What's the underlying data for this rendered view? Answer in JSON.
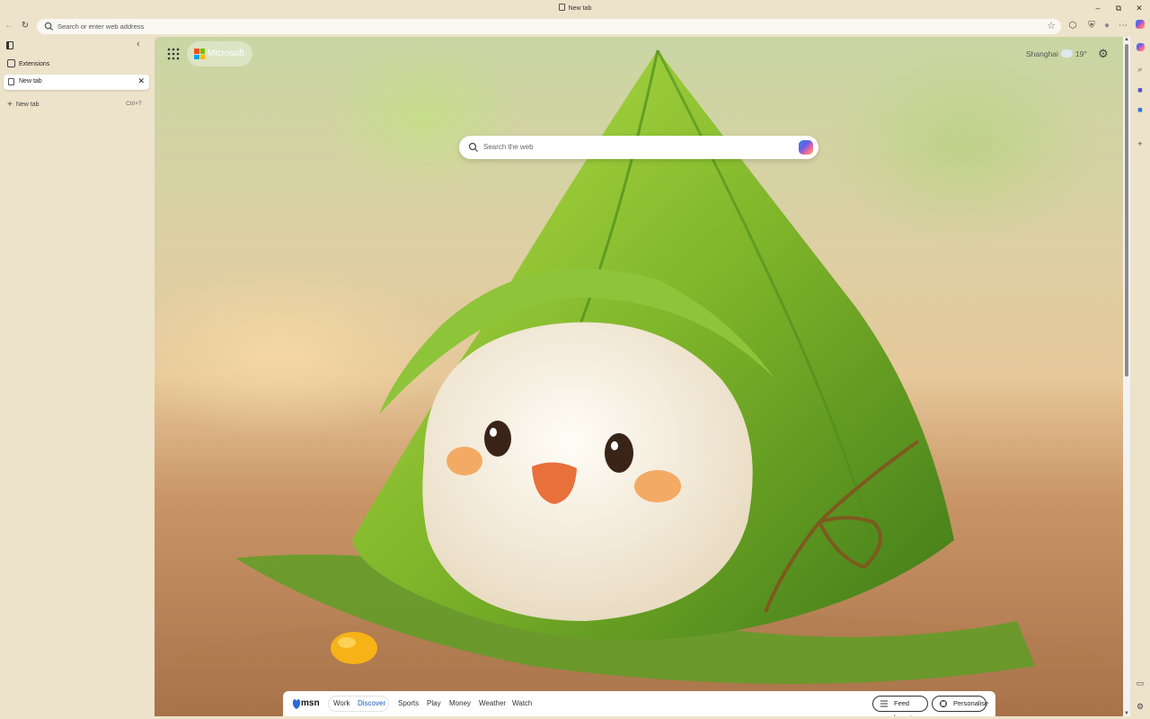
{
  "window": {
    "title": "New tab",
    "controls": {
      "minimize": "–",
      "restore": "⧉",
      "close": "✕"
    }
  },
  "toolbar": {
    "back_icon": "arrow-left",
    "refresh_icon": "refresh",
    "address_placeholder": "Search or enter web address",
    "favorite_icon": "star"
  },
  "sidebar": {
    "extensions_label": "Extensions",
    "active_tab_label": "New tab",
    "new_tab_label": "New tab",
    "new_tab_shortcut": "Ctrl+T"
  },
  "newtab": {
    "brand_label": "Microsoft",
    "weather_city": "Shanghai",
    "weather_temp": "19°",
    "search_placeholder": "Search the web",
    "msn_label": "msn",
    "feed_tabs": [
      "Work",
      "Discover",
      "Sports",
      "Play",
      "Money",
      "Weather",
      "Watch"
    ],
    "active_feed_tab": "Discover",
    "feed_layout_label": "Feed layout",
    "personalise_label": "Personalise"
  },
  "colors": {
    "chrome_bg": "#ede3cb",
    "accent_blue": "#1a5dc6",
    "leaf_green": "#7fb52a",
    "rice_white": "#f6f1e6"
  }
}
